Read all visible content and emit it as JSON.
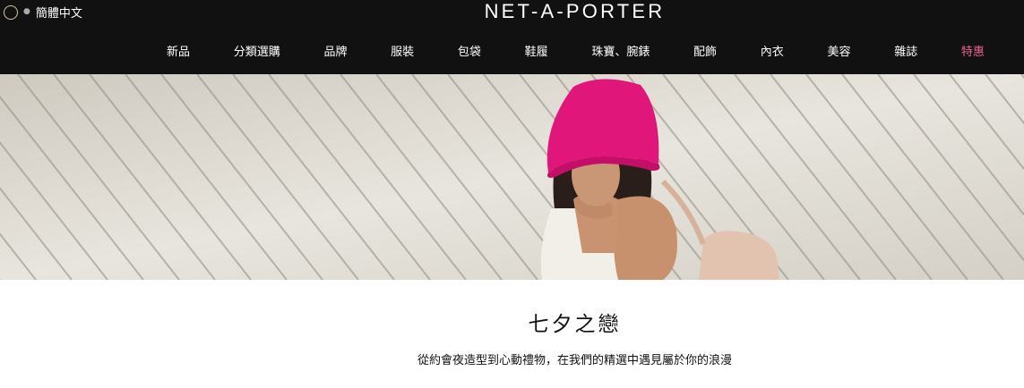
{
  "header": {
    "language_label": "簡體中文",
    "logo_text": "NET-A-PORTER"
  },
  "nav": {
    "items": [
      "新品",
      "分類選購",
      "品牌",
      "服裝",
      "包袋",
      "鞋履",
      "珠寶、腕錶",
      "配飾",
      "內衣",
      "美容",
      "雜誌"
    ],
    "sale_label": "特惠"
  },
  "colors": {
    "topbar_bg": "#111111",
    "sale_accent": "#f06292",
    "hat_pink": "#e0167a"
  },
  "hero": {
    "image_description": "model-in-pink-bucket-hat-on-wooden-deck"
  },
  "campaign": {
    "title": "七夕之戀",
    "subtitle": "從約會夜造型到心動禮物，在我們的精選中遇見屬於你的浪漫"
  }
}
